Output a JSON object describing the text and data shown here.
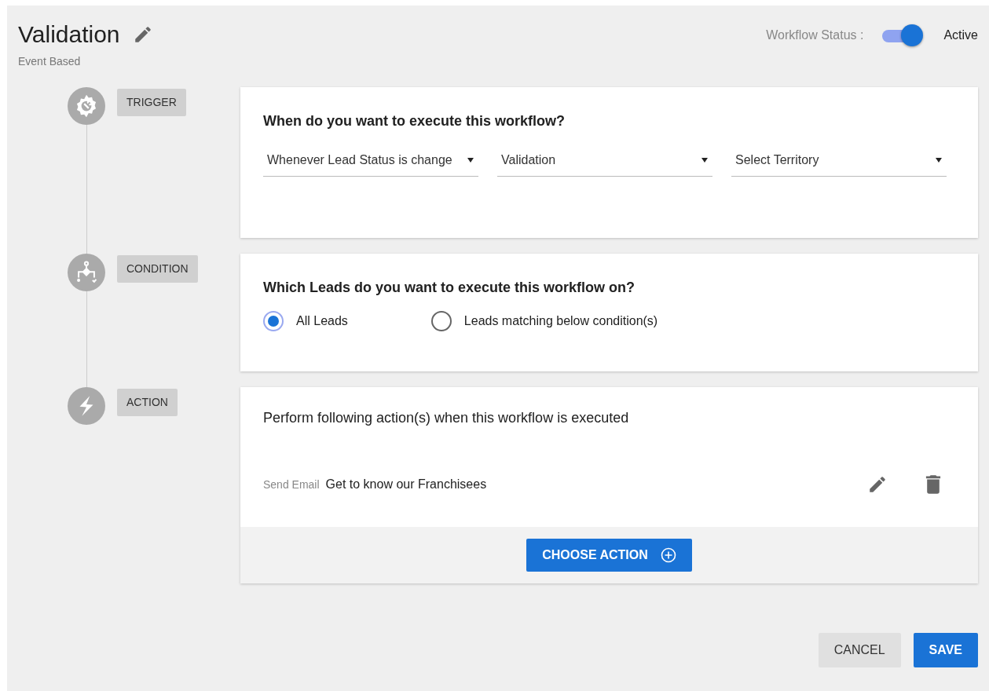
{
  "header": {
    "title": "Validation",
    "subtitle": "Event Based",
    "status_label": "Workflow Status :",
    "status_on": true,
    "status_text": "Active"
  },
  "steps": [
    {
      "kind": "trigger",
      "label": "TRIGGER",
      "question": "When do you want to execute this workflow?",
      "dropdowns": [
        {
          "value": "Whenever Lead Status is change"
        },
        {
          "value": "Validation"
        },
        {
          "value": "Select Territory"
        }
      ]
    },
    {
      "kind": "condition",
      "label": "CONDITION",
      "question": "Which Leads do you want to execute this workflow on?",
      "options": [
        {
          "label": "All Leads",
          "selected": true
        },
        {
          "label": "Leads matching below condition(s)",
          "selected": false
        }
      ]
    },
    {
      "kind": "action",
      "label": "ACTION",
      "question": "Perform following action(s) when this workflow is executed",
      "actions": [
        {
          "type": "Send Email",
          "name": "Get to know our Franchisees"
        }
      ],
      "button": "CHOOSE ACTION"
    }
  ],
  "footer": {
    "cancel": "CANCEL",
    "save": "SAVE"
  }
}
